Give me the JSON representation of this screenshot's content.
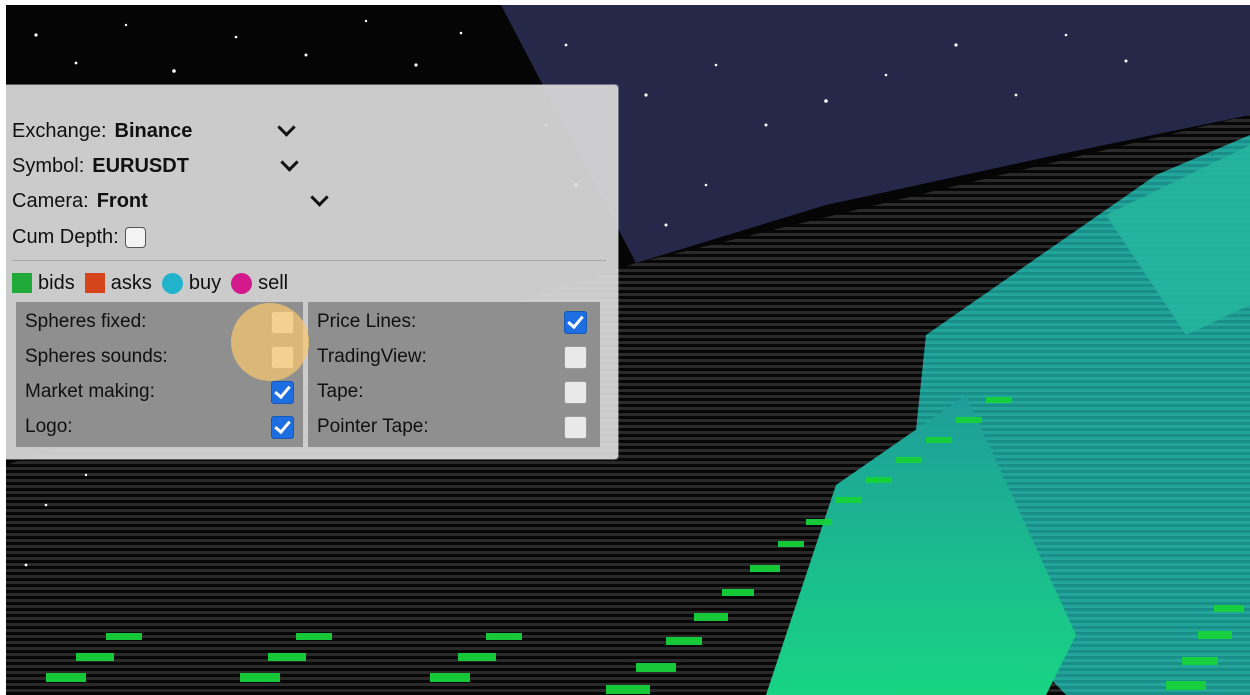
{
  "controls": {
    "exchange": {
      "label": "Exchange:",
      "value": "Binance"
    },
    "symbol": {
      "label": "Symbol:",
      "value": "EURUSDT"
    },
    "camera": {
      "label": "Camera:",
      "value": "Front"
    },
    "cum_depth": {
      "label": "Cum Depth:",
      "checked": false
    }
  },
  "legend": [
    {
      "label": "bids",
      "color": "#1faa3a",
      "shape": "square"
    },
    {
      "label": "asks",
      "color": "#d6441c",
      "shape": "square"
    },
    {
      "label": "buy",
      "color": "#21b3cc",
      "shape": "circle"
    },
    {
      "label": "sell",
      "color": "#d4198c",
      "shape": "circle"
    }
  ],
  "options_left": [
    {
      "label": "Spheres fixed:",
      "checked": false
    },
    {
      "label": "Spheres sounds:",
      "checked": false
    },
    {
      "label": "Market making:",
      "checked": true
    },
    {
      "label": "Logo:",
      "checked": true
    }
  ],
  "options_right": [
    {
      "label": "Price Lines:",
      "checked": true
    },
    {
      "label": "TradingView:",
      "checked": false
    },
    {
      "label": "Tape:",
      "checked": false
    },
    {
      "label": "Pointer Tape:",
      "checked": false
    }
  ],
  "colors": {
    "accent_checkbox": "#1d6ee0",
    "depth_surface": "#1ea88e",
    "sky": "#2a2a48",
    "cursor_highlight": "#f8c86e"
  }
}
